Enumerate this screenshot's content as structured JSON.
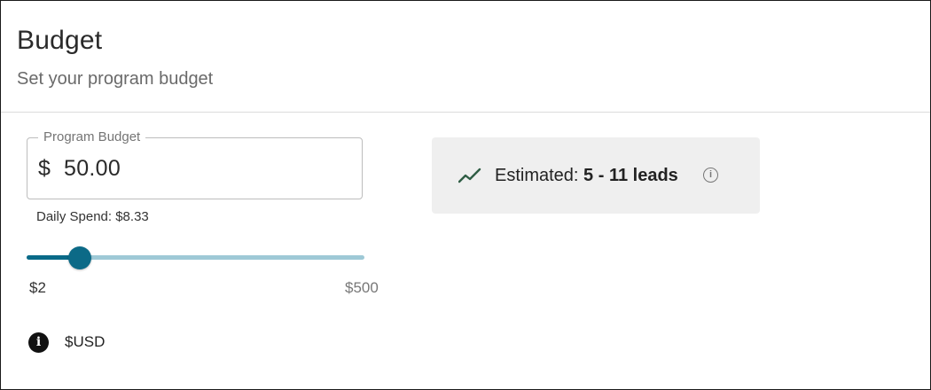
{
  "header": {
    "title": "Budget",
    "subtitle": "Set your program budget"
  },
  "budget_field": {
    "label": "Program Budget",
    "currency_symbol": "$",
    "value": "50.00"
  },
  "daily_spend": "Daily Spend: $8.33",
  "slider": {
    "min_label": "$2",
    "max_label": "$500",
    "min": 2,
    "max": 500,
    "value": 50
  },
  "currency_note": {
    "icon": "info-icon",
    "text": "$USD"
  },
  "estimate": {
    "icon": "trending-up-icon",
    "label": "Estimated:",
    "value": "5 - 11 leads",
    "help_icon": "info-outline-icon"
  },
  "colors": {
    "accent": "#0c6a87",
    "track": "#9ec9d6",
    "estimate_bg": "#efefef",
    "trend_icon": "#2f5d44"
  }
}
